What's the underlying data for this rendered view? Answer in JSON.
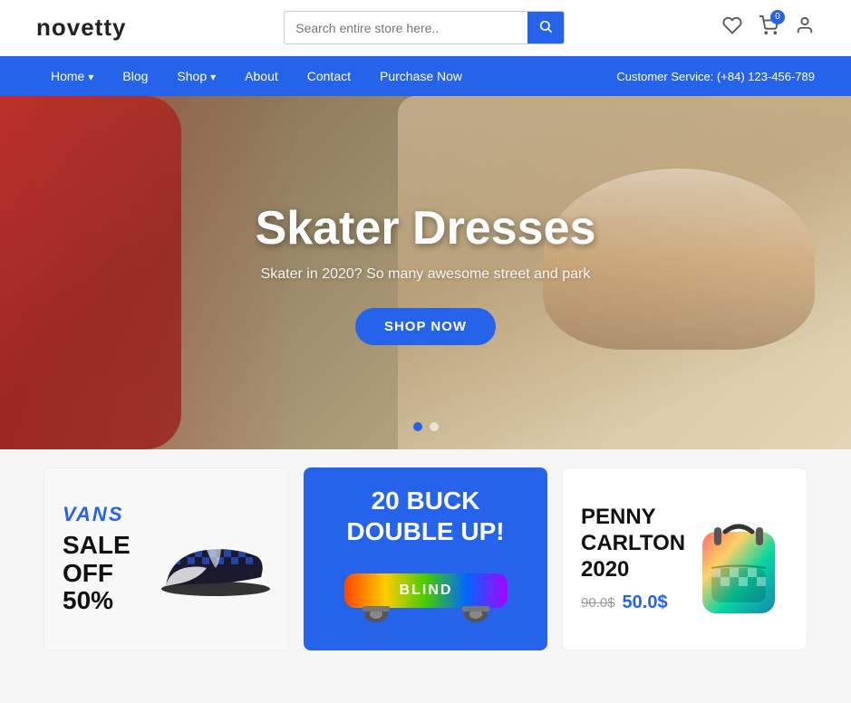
{
  "brand": "novetty",
  "header": {
    "search_placeholder": "Search entire store here..",
    "cart_count": "0"
  },
  "nav": {
    "items": [
      {
        "label": "Home",
        "has_dropdown": true
      },
      {
        "label": "Blog",
        "has_dropdown": false
      },
      {
        "label": "Shop",
        "has_dropdown": true
      },
      {
        "label": "About",
        "has_dropdown": false
      },
      {
        "label": "Contact",
        "has_dropdown": false
      },
      {
        "label": "Purchase Now",
        "has_dropdown": false
      }
    ],
    "customer_service_label": "Customer Service:",
    "customer_service_phone": "(+84) 123-456-789"
  },
  "hero": {
    "title": "Skater Dresses",
    "subtitle": "Skater in 2020? So many awesome street and park",
    "cta_label": "SHOP NOW",
    "dots": [
      {
        "active": true
      },
      {
        "active": false
      }
    ]
  },
  "cards": {
    "card1": {
      "brand": "VANS",
      "line1": "SALE",
      "line2": "OFF",
      "line3": "50%"
    },
    "card2": {
      "line1": "20 BUCK",
      "line2": "DOUBLE UP!",
      "skateboard_text": "BLIND"
    },
    "card3": {
      "title_line1": "PENNY",
      "title_line2": "CARLTON",
      "title_line3": "2020",
      "old_price": "90.0$",
      "new_price": "50.0$"
    }
  },
  "icons": {
    "search": "🔍",
    "wishlist": "♡",
    "cart": "🛒",
    "account": "👤"
  }
}
